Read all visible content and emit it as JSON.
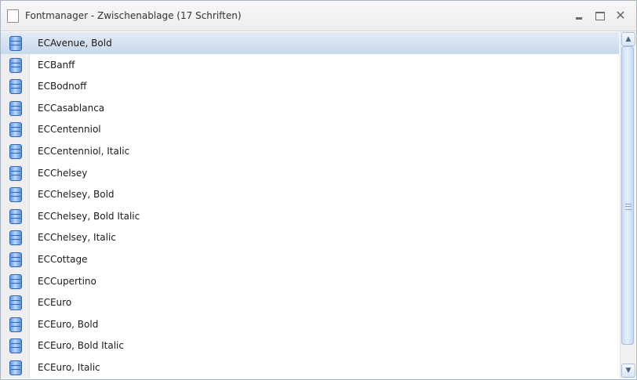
{
  "window": {
    "title": "Fontmanager - Zwischenablage (17 Schriften)",
    "controls": {
      "close": "✕"
    }
  },
  "fonts": [
    {
      "label": "ECAvenue, Bold",
      "selected": true
    },
    {
      "label": "ECBanff"
    },
    {
      "label": "ECBodnoff"
    },
    {
      "label": "ECCasablanca"
    },
    {
      "label": "ECCentenniol"
    },
    {
      "label": "ECCentenniol, Italic"
    },
    {
      "label": "ECChelsey"
    },
    {
      "label": "ECChelsey, Bold"
    },
    {
      "label": "ECChelsey, Bold Italic"
    },
    {
      "label": "ECChelsey, Italic"
    },
    {
      "label": "ECCottage"
    },
    {
      "label": "ECCupertino"
    },
    {
      "label": "ECEuro"
    },
    {
      "label": "ECEuro, Bold"
    },
    {
      "label": "ECEuro, Bold Italic"
    },
    {
      "label": "ECEuro, Italic"
    }
  ],
  "scrollbar": {
    "up_arrow": "▲",
    "down_arrow": "▼",
    "thumb_fraction": 0.94
  },
  "colors": {
    "selected_row": "#c9d8ec",
    "icon_column": "#eeeeee",
    "db_icon": "#5b96e0"
  }
}
